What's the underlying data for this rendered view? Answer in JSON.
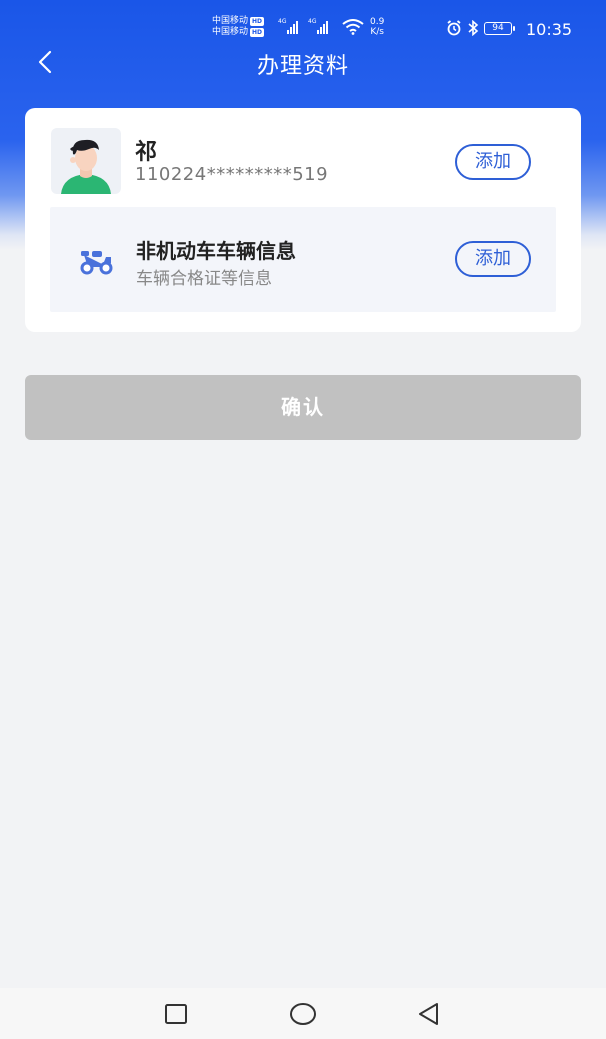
{
  "status_bar": {
    "carrier_1": "中国移动",
    "carrier_2": "中国移动",
    "hd_label": "HD",
    "net_type_1": "4G",
    "net_type_2": "4G",
    "speed_value": "0.9",
    "speed_unit": "K/s",
    "battery": "94",
    "time": "10:35"
  },
  "header": {
    "title": "办理资料",
    "back_icon": "chevron-left-icon"
  },
  "person": {
    "name": "祁",
    "id_number": "110224*********519",
    "add_label": "添加"
  },
  "vehicle": {
    "title": "非机动车车辆信息",
    "subtitle": "车辆合格证等信息",
    "add_label": "添加",
    "icon": "scooter-icon"
  },
  "confirm": {
    "label": "确认"
  },
  "nav_bar": {
    "recent_icon": "square-icon",
    "home_icon": "circle-icon",
    "back_icon": "triangle-back-icon"
  },
  "colors": {
    "primary": "#2e5fd6",
    "header_blue": "#1a56e8",
    "disabled_button": "#c1c1c1"
  }
}
